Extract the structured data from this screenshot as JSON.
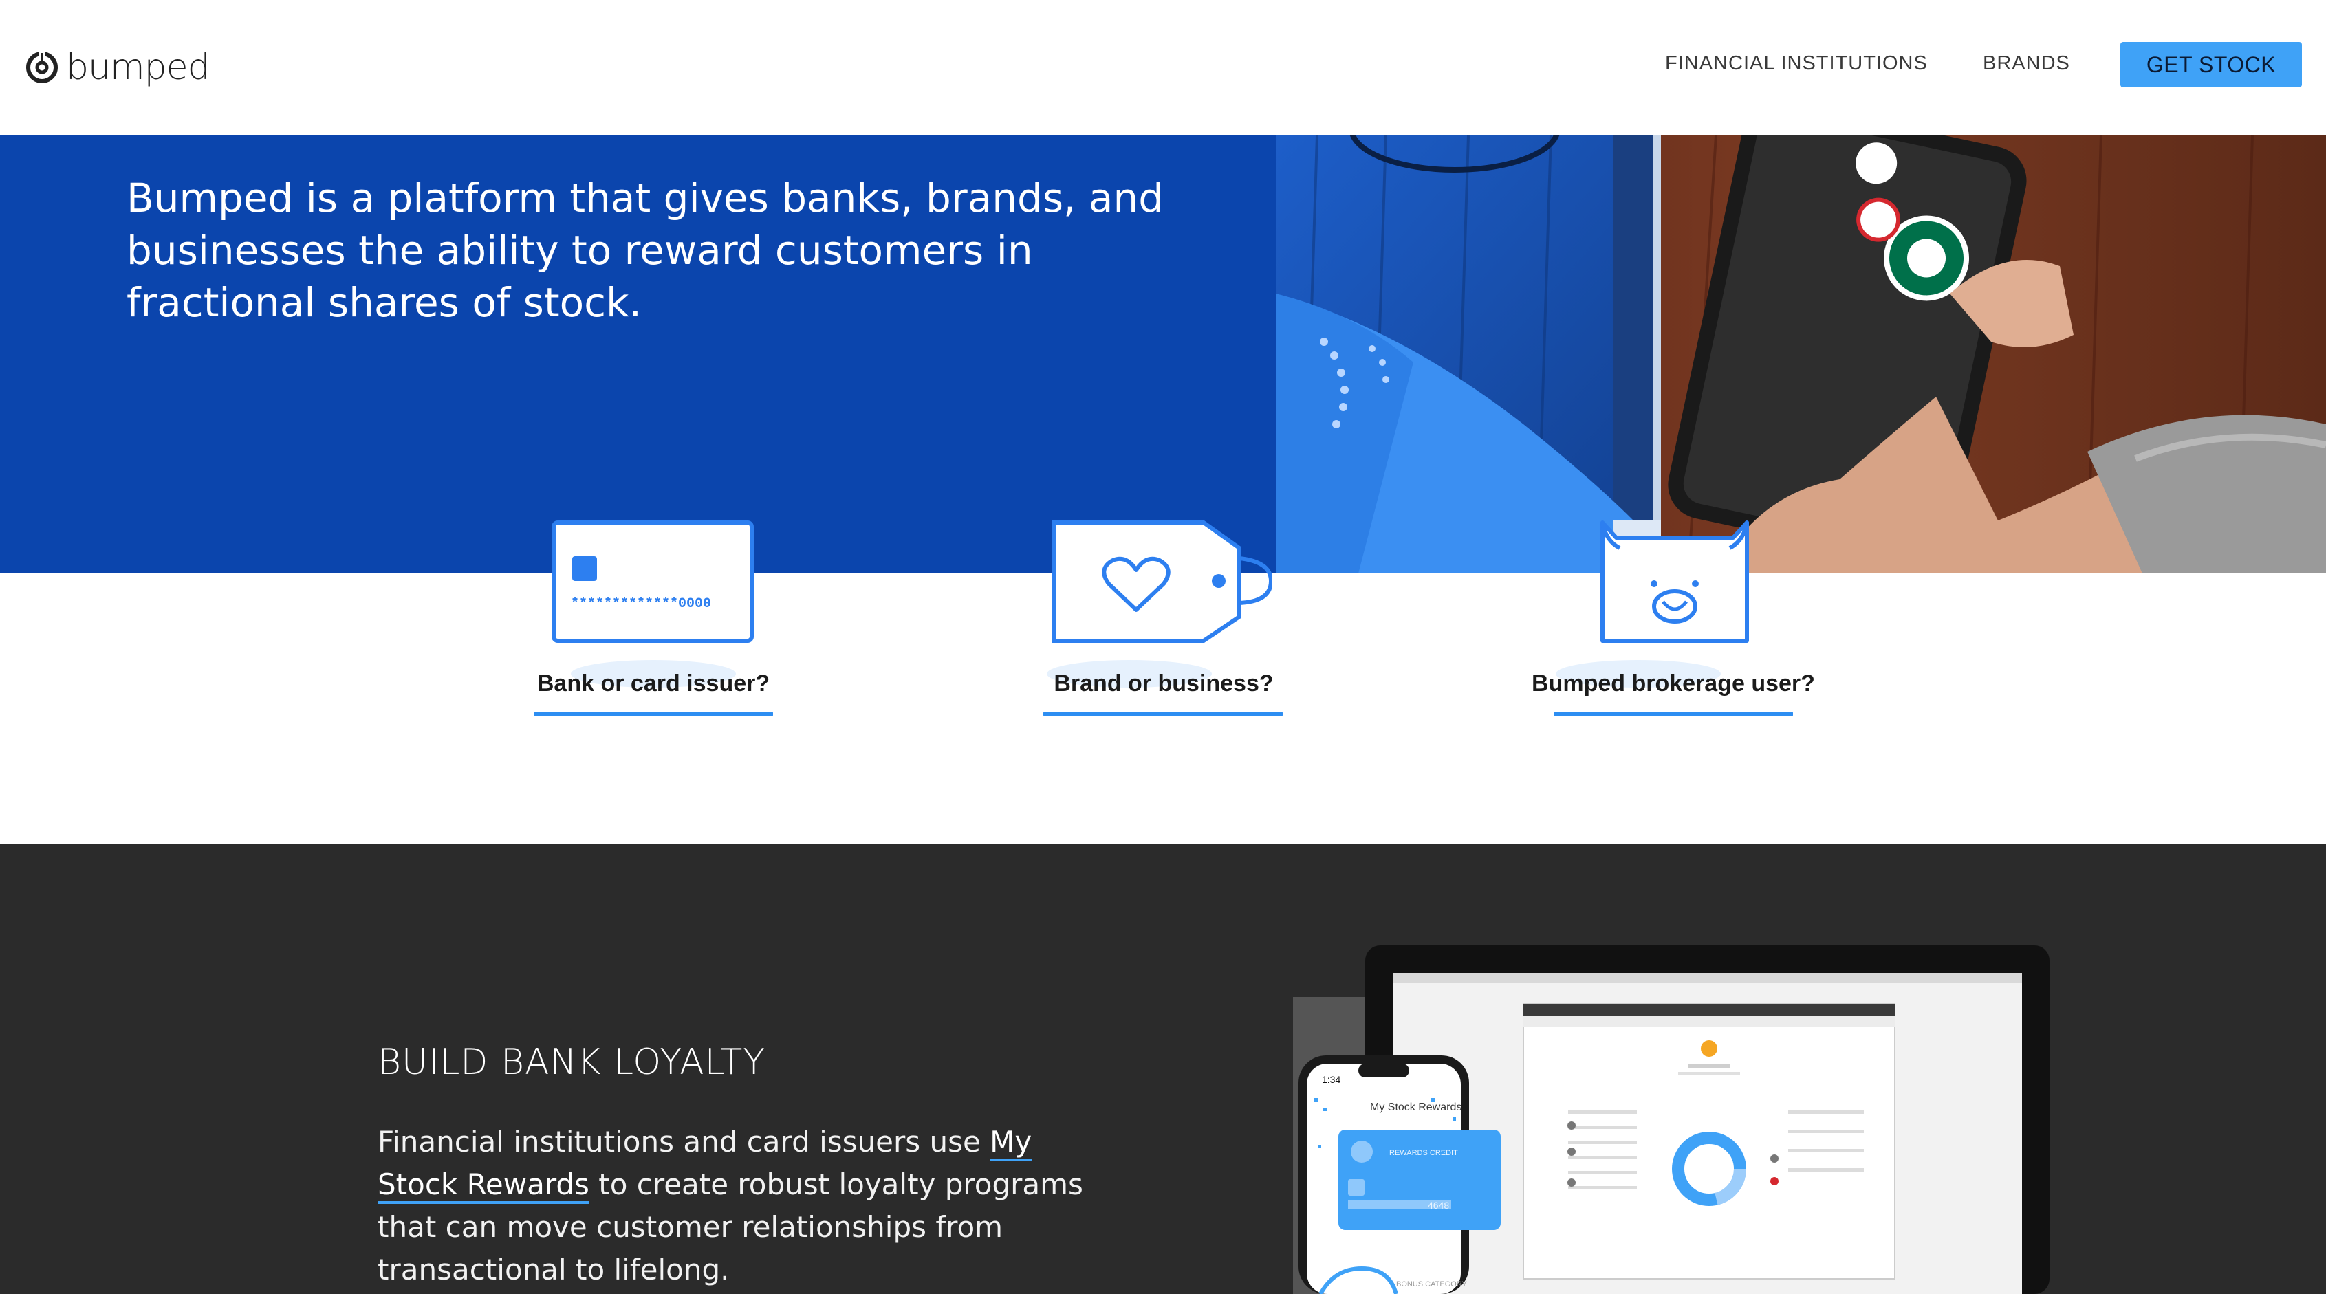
{
  "header": {
    "logo_text": "bumped",
    "nav": {
      "financial_institutions": "FINANCIAL INSTITUTIONS",
      "brands": "BRANDS",
      "get_stock": "GET STOCK"
    }
  },
  "hero": {
    "headline": "Bumped is a platform that gives banks, brands, and businesses the ability to reward customers in fractional shares of stock."
  },
  "choices": [
    {
      "label": "Bank or card issuer?",
      "icon": "credit-card-icon"
    },
    {
      "label": "Brand or business?",
      "icon": "heart-tag-icon"
    },
    {
      "label": "Bumped brokerage user?",
      "icon": "bull-icon"
    }
  ],
  "loyalty": {
    "title": "BUILD BANK LOYALTY",
    "body_before": "Financial institutions and card issuers use ",
    "link": "My Stock Rewards",
    "body_after": " to create robust loyalty programs that can move customer relationships from transactional to lifelong."
  },
  "card_number_mask": "*************0000",
  "phone_ui": {
    "time": "1:34",
    "title": "My Stock Rewards",
    "card_label": "REWARDS CREDIT",
    "card_last4": "4648",
    "bonus": "BONUS CATEGORY"
  },
  "colors": {
    "accent": "#3fa2f7",
    "hero_blue": "#0b45ad",
    "dark_bg": "#2b2b2b",
    "icon_blue": "#2d7ff0"
  }
}
